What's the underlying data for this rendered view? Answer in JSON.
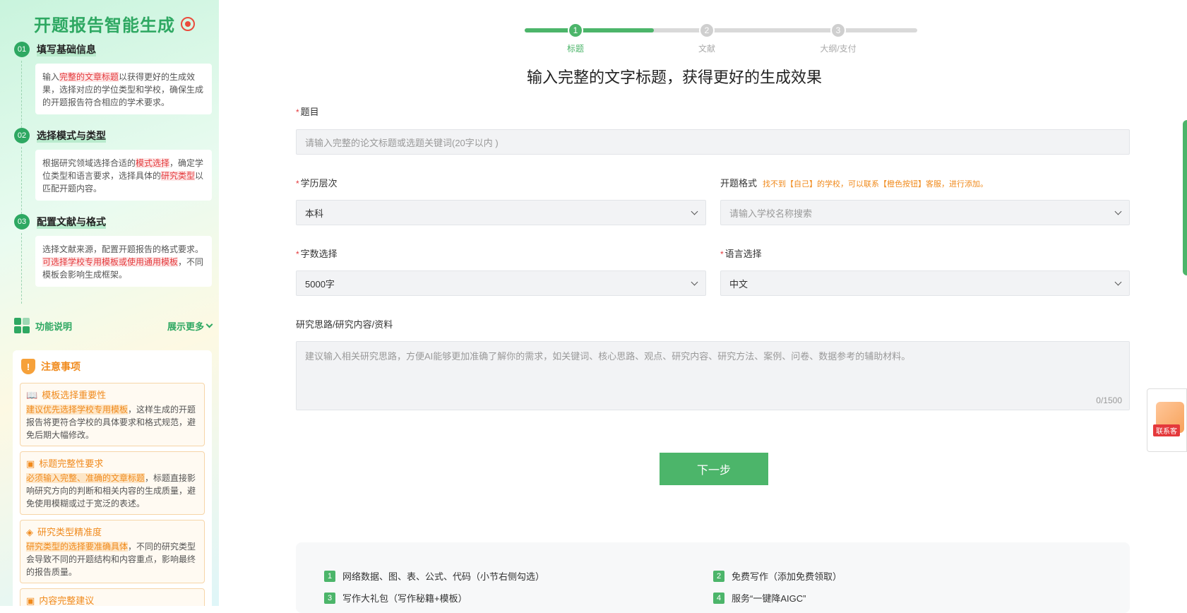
{
  "sidebar": {
    "title": "开题报告智能生成",
    "steps": [
      {
        "num": "01",
        "label": "填写基础信息",
        "text_before": "输入",
        "hl1": "完整的文章标题",
        "text_mid": "以获得更好的生成效果，选择对应的学位类型和学校，确保生成的开题报告符合相应的学术要求。"
      },
      {
        "num": "02",
        "label": "选择模式与类型",
        "text_before": "根据研究领域选择合适的",
        "hl1": "模式选择",
        "text_mid": "，确定学位类型和语言要求，选择具体的",
        "hl2": "研究类型",
        "text_after": "以匹配开题内容。"
      },
      {
        "num": "03",
        "label": "配置文献与格式",
        "text_before": "选择文献来源，配置开题报告的格式要求。",
        "hl1": "可选择学校专用模板或使用通用模板",
        "text_mid": "，不同模板会影响生成框架。"
      }
    ],
    "feature": {
      "label": "功能说明",
      "more": "展示更多"
    },
    "notice": {
      "title": "注意事项",
      "cards": [
        {
          "title": "模板选择重要性",
          "hl": "建议优先选择学校专用模板",
          "text": "，这样生成的开题报告将更符合学校的具体要求和格式规范，避免后期大幅修改。"
        },
        {
          "title": "标题完整性要求",
          "hl": "必须输入完整、准确的文章标题",
          "text": "，标题直接影响研究方向的判断和相关内容的生成质量，避免使用模糊或过于宽泛的表述。"
        },
        {
          "title": "研究类型精准度",
          "hl": "研究类型的选择要准确具体",
          "text": "，不同的研究类型会导致不同的开题结构和内容重点，影响最终的报告质量。"
        },
        {
          "title": "内容完整建议",
          "hl": "",
          "text": ""
        }
      ]
    }
  },
  "progress": {
    "steps": [
      {
        "num": "1",
        "label": "标题"
      },
      {
        "num": "2",
        "label": "文献"
      },
      {
        "num": "3",
        "label": "大纲/支付"
      }
    ],
    "current": 1,
    "fill_fraction": 0.33
  },
  "form": {
    "heading": "输入完整的文字标题，获得更好的生成效果",
    "topic": {
      "label": "题目",
      "placeholder": "请输入完整的论文标题或选题关键词(20字以内 )"
    },
    "degree": {
      "label": "学历层次",
      "value": "本科"
    },
    "format": {
      "label": "开题格式",
      "hint": "找不到【自己】的学校，可以联系【橙色按钮】客服，进行添加。",
      "placeholder": "请输入学校名称搜索"
    },
    "words": {
      "label": "字数选择",
      "value": "5000字"
    },
    "language": {
      "label": "语言选择",
      "value": "中文"
    },
    "research": {
      "label": "研究思路/研究内容/资料",
      "placeholder": "建议输入相关研究思路，方便AI能够更加准确了解你的需求，如关键词、核心思路、观点、研究内容、研究方法、案例、问卷、数据参考的辅助材料。",
      "counter": "0/1500"
    },
    "next_label": "下一步"
  },
  "benefits": [
    {
      "num": "1",
      "text": "网络数据、图、表、公式、代码（小节右侧勾选）"
    },
    {
      "num": "2",
      "text": "免费写作（添加免费领取）"
    },
    {
      "num": "3",
      "text": "写作大礼包（写作秘籍+模板）"
    },
    {
      "num": "4",
      "text": "服务“一键降AIGC”"
    }
  ],
  "contact": {
    "label": "联系客"
  },
  "colors": {
    "accent": "#4cb56a",
    "title_green": "#2ea862",
    "warn_orange": "#f08a1c",
    "required_red": "#e4393c"
  }
}
